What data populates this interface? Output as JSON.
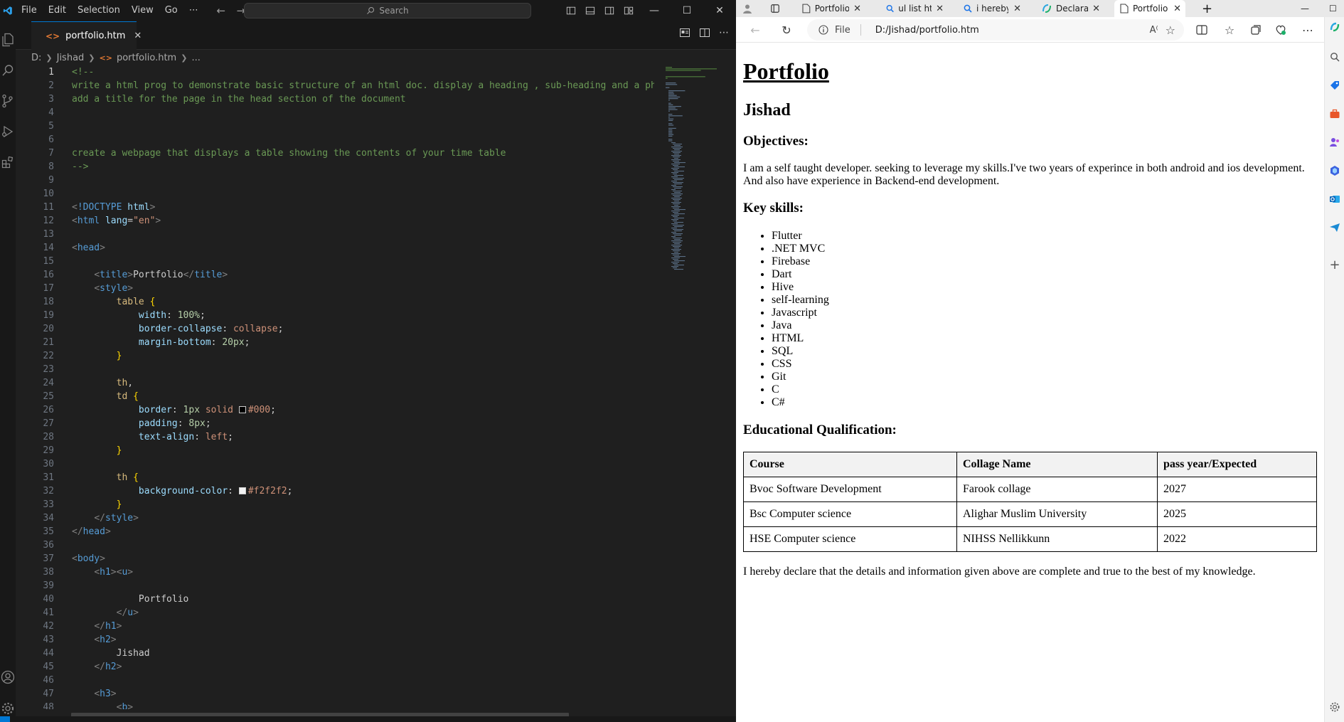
{
  "vscode": {
    "menu": [
      "File",
      "Edit",
      "Selection",
      "View",
      "Go",
      "⋯"
    ],
    "search_placeholder": "Search",
    "tab_label": "portfolio.htm",
    "breadcrumb": [
      "D:",
      "Jishad",
      "portfolio.htm",
      "..."
    ],
    "code_lines": [
      {
        "n": "1",
        "html": "<span class='tk-com'>&lt;!--</span>"
      },
      {
        "n": "2",
        "html": "<span class='tk-com'>write a html prog to demonstrate basic structure of an html doc. display a heading , sub-heading and a pha</span>"
      },
      {
        "n": "3",
        "html": "<span class='tk-com'>add a title for the page in the head section of the document</span>"
      },
      {
        "n": "4",
        "html": ""
      },
      {
        "n": "5",
        "html": ""
      },
      {
        "n": "6",
        "html": ""
      },
      {
        "n": "7",
        "html": "<span class='tk-com'>create a webpage that displays a table showing the contents of your time table</span>"
      },
      {
        "n": "8",
        "html": "<span class='tk-com'>--&gt;</span>"
      },
      {
        "n": "9",
        "html": ""
      },
      {
        "n": "10",
        "html": ""
      },
      {
        "n": "11",
        "html": "<span class='tk-brack'>&lt;</span><span class='tk-doctype'>!DOCTYPE</span> <span class='tk-attr'>html</span><span class='tk-brack'>&gt;</span>"
      },
      {
        "n": "12",
        "html": "<span class='tk-brack'>&lt;</span><span class='tk-tag'>html</span> <span class='tk-attr'>lang</span><span class='tk-punc'>=</span><span class='tk-str'>\"en\"</span><span class='tk-brack'>&gt;</span>"
      },
      {
        "n": "13",
        "html": ""
      },
      {
        "n": "14",
        "html": "<span class='tk-brack'>&lt;</span><span class='tk-tag'>head</span><span class='tk-brack'>&gt;</span>"
      },
      {
        "n": "15",
        "html": ""
      },
      {
        "n": "16",
        "html": "    <span class='tk-brack'>&lt;</span><span class='tk-tag'>title</span><span class='tk-brack'>&gt;</span><span class='tk-text'>Portfolio</span><span class='tk-brack'>&lt;/</span><span class='tk-tag'>title</span><span class='tk-brack'>&gt;</span>"
      },
      {
        "n": "17",
        "html": "    <span class='tk-brack'>&lt;</span><span class='tk-tag'>style</span><span class='tk-brack'>&gt;</span>"
      },
      {
        "n": "18",
        "html": "        <span class='tk-sel'>table</span> <span class='tk-brace'>{</span>"
      },
      {
        "n": "19",
        "html": "            <span class='tk-prop'>width</span><span class='tk-punc'>: </span><span class='tk-num'>100%</span><span class='tk-punc'>;</span>"
      },
      {
        "n": "20",
        "html": "            <span class='tk-prop'>border-collapse</span><span class='tk-punc'>: </span><span class='tk-val'>collapse</span><span class='tk-punc'>;</span>"
      },
      {
        "n": "21",
        "html": "            <span class='tk-prop'>margin-bottom</span><span class='tk-punc'>: </span><span class='tk-num'>20px</span><span class='tk-punc'>;</span>"
      },
      {
        "n": "22",
        "html": "        <span class='tk-brace'>}</span>"
      },
      {
        "n": "23",
        "html": ""
      },
      {
        "n": "24",
        "html": "        <span class='tk-sel'>th</span><span class='tk-punc'>,</span>"
      },
      {
        "n": "25",
        "html": "        <span class='tk-sel'>td</span> <span class='tk-brace'>{</span>"
      },
      {
        "n": "26",
        "html": "            <span class='tk-prop'>border</span><span class='tk-punc'>: </span><span class='tk-num'>1px</span> <span class='tk-val'>solid</span> <span class='swatch' style='background:#000'></span><span class='tk-val'>#000</span><span class='tk-punc'>;</span>"
      },
      {
        "n": "27",
        "html": "            <span class='tk-prop'>padding</span><span class='tk-punc'>: </span><span class='tk-num'>8px</span><span class='tk-punc'>;</span>"
      },
      {
        "n": "28",
        "html": "            <span class='tk-prop'>text-align</span><span class='tk-punc'>: </span><span class='tk-val'>left</span><span class='tk-punc'>;</span>"
      },
      {
        "n": "29",
        "html": "        <span class='tk-brace'>}</span>"
      },
      {
        "n": "30",
        "html": ""
      },
      {
        "n": "31",
        "html": "        <span class='tk-sel'>th</span> <span class='tk-brace'>{</span>"
      },
      {
        "n": "32",
        "html": "            <span class='tk-prop'>background-color</span><span class='tk-punc'>: </span><span class='swatch' style='background:#f2f2f2'></span><span class='tk-val'>#f2f2f2</span><span class='tk-punc'>;</span>"
      },
      {
        "n": "33",
        "html": "        <span class='tk-brace'>}</span>"
      },
      {
        "n": "34",
        "html": "    <span class='tk-brack'>&lt;/</span><span class='tk-tag'>style</span><span class='tk-brack'>&gt;</span>"
      },
      {
        "n": "35",
        "html": "<span class='tk-brack'>&lt;/</span><span class='tk-tag'>head</span><span class='tk-brack'>&gt;</span>"
      },
      {
        "n": "36",
        "html": ""
      },
      {
        "n": "37",
        "html": "<span class='tk-brack'>&lt;</span><span class='tk-tag'>body</span><span class='tk-brack'>&gt;</span>"
      },
      {
        "n": "38",
        "html": "    <span class='tk-brack'>&lt;</span><span class='tk-tag'>h1</span><span class='tk-brack'>&gt;&lt;</span><span class='tk-tag'>u</span><span class='tk-brack'>&gt;</span>"
      },
      {
        "n": "39",
        "html": ""
      },
      {
        "n": "40",
        "html": "            <span class='tk-text'>Portfolio</span>"
      },
      {
        "n": "41",
        "html": "        <span class='tk-brack'>&lt;/</span><span class='tk-tag'>u</span><span class='tk-brack'>&gt;</span>"
      },
      {
        "n": "42",
        "html": "    <span class='tk-brack'>&lt;/</span><span class='tk-tag'>h1</span><span class='tk-brack'>&gt;</span>"
      },
      {
        "n": "43",
        "html": "    <span class='tk-brack'>&lt;</span><span class='tk-tag'>h2</span><span class='tk-brack'>&gt;</span>"
      },
      {
        "n": "44",
        "html": "        <span class='tk-text'>Jishad</span>"
      },
      {
        "n": "45",
        "html": "    <span class='tk-brack'>&lt;/</span><span class='tk-tag'>h2</span><span class='tk-brack'>&gt;</span>"
      },
      {
        "n": "46",
        "html": ""
      },
      {
        "n": "47",
        "html": "    <span class='tk-brack'>&lt;</span><span class='tk-tag'>h3</span><span class='tk-brack'>&gt;</span>"
      },
      {
        "n": "48",
        "html": "        <span class='tk-brack'>&lt;</span><span class='tk-tag'>b</span><span class='tk-brack'>&gt;</span>"
      }
    ]
  },
  "browser": {
    "tabs": [
      {
        "label": "Portfolio",
        "icon": "page-icon"
      },
      {
        "label": "ul list htm",
        "icon": "search-icon"
      },
      {
        "label": "i hereby",
        "icon": "search-icon"
      },
      {
        "label": "Declarati",
        "icon": "copilot-icon"
      },
      {
        "label": "Portfolio",
        "icon": "page-icon",
        "active": true
      }
    ],
    "address_prefix": "File",
    "address": "D:/Jishad/portfolio.htm"
  },
  "page": {
    "h1": "Portfolio",
    "h2": "Jishad",
    "objectives_heading": "Objectives:",
    "objectives_text": "I am a self taught developer. seeking to leverage my skills.I've two years of experince in both android and ios development. And also have experience in Backend-end development.",
    "skills_heading": "Key skills:",
    "skills": [
      "Flutter",
      ".NET MVC",
      "Firebase",
      "Dart",
      "Hive",
      "self-learning",
      "Javascript",
      "Java",
      "HTML",
      "SQL",
      "CSS",
      "Git",
      "C",
      "C#"
    ],
    "edu_heading": "Educational Qualification:",
    "table_headers": [
      "Course",
      "Collage Name",
      "pass year/Expected"
    ],
    "table_rows": [
      [
        "Bvoc Software Development",
        "Farook collage",
        "2027"
      ],
      [
        "Bsc Computer science",
        "Alighar Muslim University",
        "2025"
      ],
      [
        "HSE Computer science",
        "NIHSS Nellikkunn",
        "2022"
      ]
    ],
    "declaration": "I hereby declare that the details and information given above are complete and true to the best of my knowledge."
  },
  "colors": {
    "vscode_bg": "#1f1f1f",
    "vscode_accent": "#0078d4",
    "comment": "#6a9955",
    "tag": "#569cd6"
  }
}
